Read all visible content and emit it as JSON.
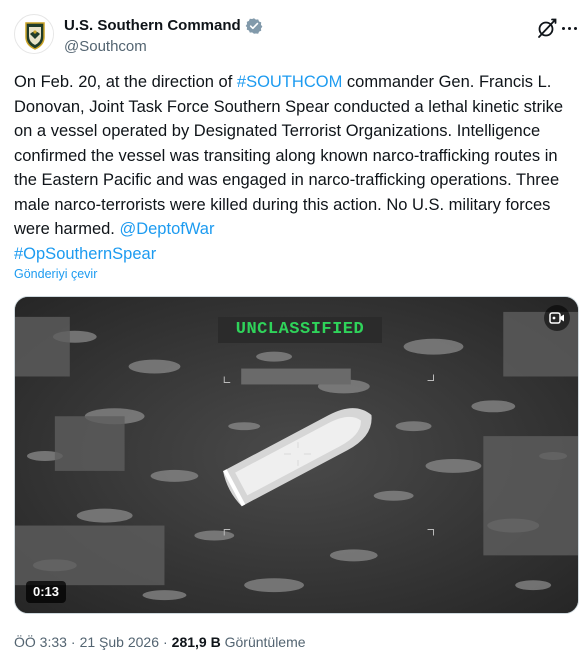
{
  "author": {
    "display_name": "U.S. Southern Command",
    "handle": "@Southcom",
    "verified_badge_color": "#829aab"
  },
  "tweet": {
    "text_parts": {
      "p1": "On Feb. 20, at the direction of ",
      "hashtag1": "#SOUTHCOM",
      "p2": " commander Gen. Francis L. Donovan, Joint Task Force Southern Spear conducted a lethal kinetic strike on a vessel operated by Designated Terrorist Organizations. Intelligence confirmed the vessel was transiting along known narco-trafficking routes in the Eastern Pacific and was engaged in narco-trafficking operations. Three male narco-terrorists were killed during this action. No U.S. military forces were harmed. ",
      "mention": "@DeptofWar",
      "hashtag2": "#OpSouthernSpear"
    },
    "translate_link": "Gönderiyi çevir",
    "link_color": "#1d9bf0"
  },
  "media": {
    "overlay_label": "UNCLASSIFIED",
    "overlay_color": "#2fd35a",
    "duration": "0:13",
    "video_icon": "video-camera-icon"
  },
  "meta": {
    "time": "ÖÖ 3:33",
    "date": "21 Şub 2026",
    "views_count": "281,9 B",
    "views_label": "Görüntüleme",
    "separator": "·"
  },
  "icons": {
    "grok": "grok-icon",
    "more": "more-options-icon",
    "verified": "verified-badge-icon"
  }
}
